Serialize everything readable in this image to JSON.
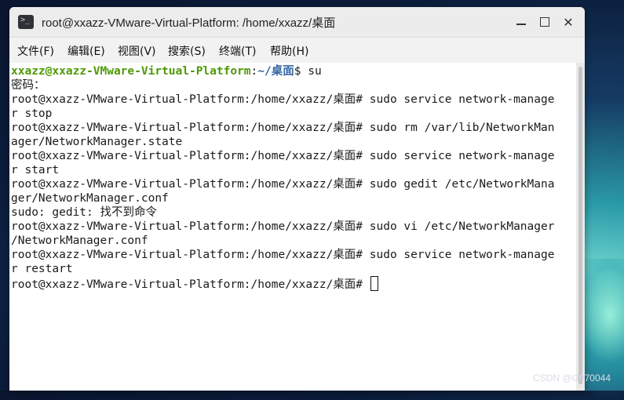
{
  "window": {
    "title": "root@xxazz-VMware-Virtual-Platform: /home/xxazz/桌面",
    "icon": "terminal-icon",
    "controls": {
      "minimize": "minimize-icon",
      "maximize": "maximize-icon",
      "close": "✕"
    }
  },
  "menu": {
    "items": [
      "文件(F)",
      "编辑(E)",
      "视图(V)",
      "搜索(S)",
      "终端(T)",
      "帮助(H)"
    ]
  },
  "terminal": {
    "first_prompt": {
      "user": "xxazz@xxazz-VMware-Virtual-Platform",
      "colon": ":",
      "path": "~/桌面",
      "rest": "$ su"
    },
    "lines": [
      "密码：",
      "root@xxazz-VMware-Virtual-Platform:/home/xxazz/桌面# sudo service network-manage",
      "r stop",
      "root@xxazz-VMware-Virtual-Platform:/home/xxazz/桌面# sudo rm /var/lib/NetworkMan",
      "ager/NetworkManager.state",
      "root@xxazz-VMware-Virtual-Platform:/home/xxazz/桌面# sudo service network-manage",
      "r start",
      "root@xxazz-VMware-Virtual-Platform:/home/xxazz/桌面# sudo gedit /etc/NetworkMana",
      "ger/NetworkManager.conf",
      "sudo: gedit: 找不到命令",
      "root@xxazz-VMware-Virtual-Platform:/home/xxazz/桌面# sudo vi /etc/NetworkManager",
      "/NetworkManager.conf",
      "root@xxazz-VMware-Virtual-Platform:/home/xxazz/桌面# sudo service network-manage",
      "r restart"
    ],
    "current_prompt": "root@xxazz-VMware-Virtual-Platform:/home/xxazz/桌面# "
  },
  "watermark": "CSDN @G070044"
}
